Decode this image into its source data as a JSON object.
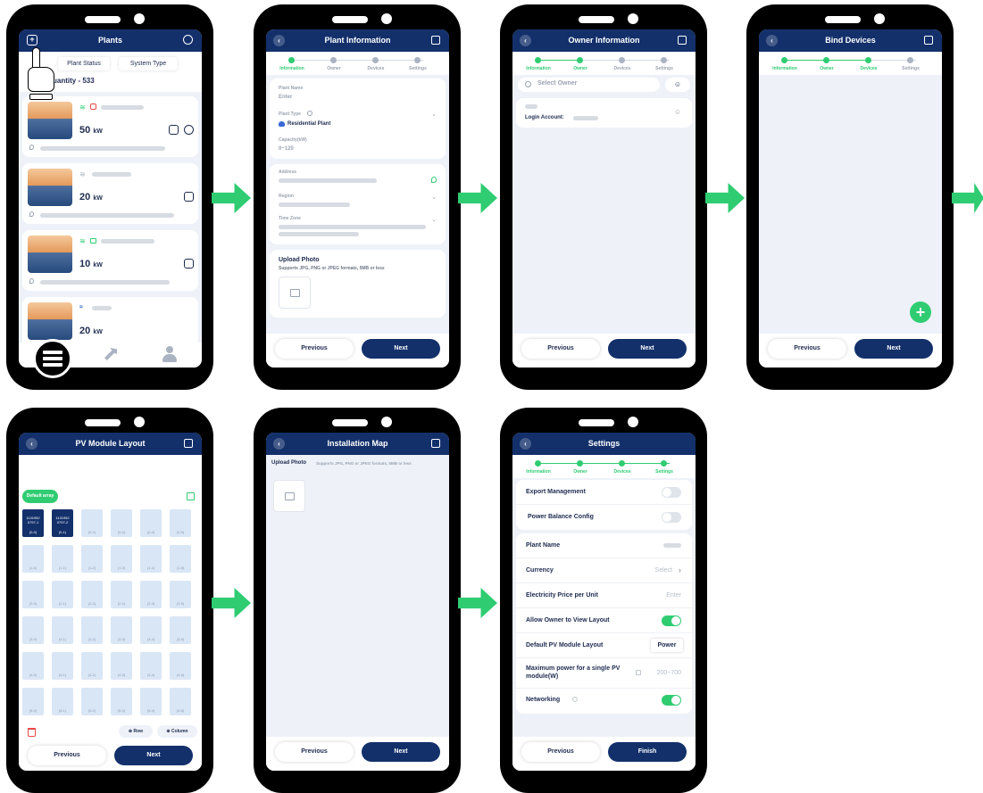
{
  "steps": [
    "Information",
    "Owner",
    "Devices",
    "Settings"
  ],
  "buttons": {
    "previous": "Previous",
    "next": "Next",
    "finish": "Finish"
  },
  "colors": {
    "header": "#13306b",
    "accent_green": "#2fcc72",
    "screen_bg": "#eef2f8"
  },
  "plants": {
    "title": "Plants",
    "filters": [
      "Plant Status",
      "System Type"
    ],
    "quantity": "uantity - 533",
    "cards": [
      {
        "capacity": "50",
        "unit": "kW"
      },
      {
        "capacity": "20",
        "unit": "kW"
      },
      {
        "capacity": "10",
        "unit": "kW"
      },
      {
        "capacity": "20",
        "unit": "kW"
      }
    ]
  },
  "plant_info": {
    "title": "Plant Information",
    "plant_name_label": "Plant Name",
    "plant_name_placeholder": "Enter",
    "plant_type_label": "Plant Type",
    "plant_type_value": "Residential Plant",
    "capacity_label": "Capacity(kW)",
    "capacity_placeholder": "0~120",
    "address_label": "Address",
    "region_label": "Region",
    "timezone_label": "Time Zone",
    "upload_title": "Upload Photo",
    "upload_hint": "Supports JPG, PNG or JPEG formats, 5MB or less"
  },
  "owner_info": {
    "title": "Owner Information",
    "search_placeholder": "Select Owner",
    "login_label": "Login Account:"
  },
  "bind_devices": {
    "title": "Bind Devices"
  },
  "pv_layout": {
    "title": "PV Module Layout",
    "array_label": "Default array",
    "selected_cells": [
      [
        "1131952",
        "0797-1",
        "(0-0)"
      ],
      [
        "1131952",
        "0797-2",
        "(0-1)"
      ]
    ],
    "cell_labels": [
      [
        "(0-0)",
        "(0-1)",
        "(0-2)",
        "(0-3)",
        "(0-4)",
        "(0-5)"
      ],
      [
        "(1-0)",
        "(1-1)",
        "(1-2)",
        "(1-3)",
        "(1-4)",
        "(1-5)"
      ],
      [
        "(2-0)",
        "(2-1)",
        "(2-2)",
        "(2-3)",
        "(2-4)",
        "(2-5)"
      ],
      [
        "(3-0)",
        "(3-1)",
        "(3-2)",
        "(3-3)",
        "(3-4)",
        "(3-5)"
      ],
      [
        "(4-0)",
        "(4-1)",
        "(4-2)",
        "(4-3)",
        "(4-4)",
        "(4-5)"
      ],
      [
        "(5-0)",
        "(5-1)",
        "(5-2)",
        "(5-3)",
        "(5-4)",
        "(5-5)"
      ]
    ],
    "row_button": "Row",
    "column_button": "Column"
  },
  "install_map": {
    "title": "Installation Map",
    "upload_title": "Upload Photo",
    "upload_hint": "Supports JPG, PNG or JPEG formats, 5MB or less"
  },
  "settings": {
    "title": "Settings",
    "export_management": "Export Management",
    "power_balance": "Power Balance Config",
    "plant_name": "Plant Name",
    "currency": "Currency",
    "currency_value": "Select",
    "price": "Electricity Price per Unit",
    "price_placeholder": "Enter",
    "allow_owner": "Allow Owner to View Layout",
    "default_layout": "Default PV Module Layout",
    "default_layout_value": "Power",
    "max_power": "Maximum power for a single PV module(W)",
    "max_power_placeholder": "200~700",
    "networking": "Networking"
  }
}
